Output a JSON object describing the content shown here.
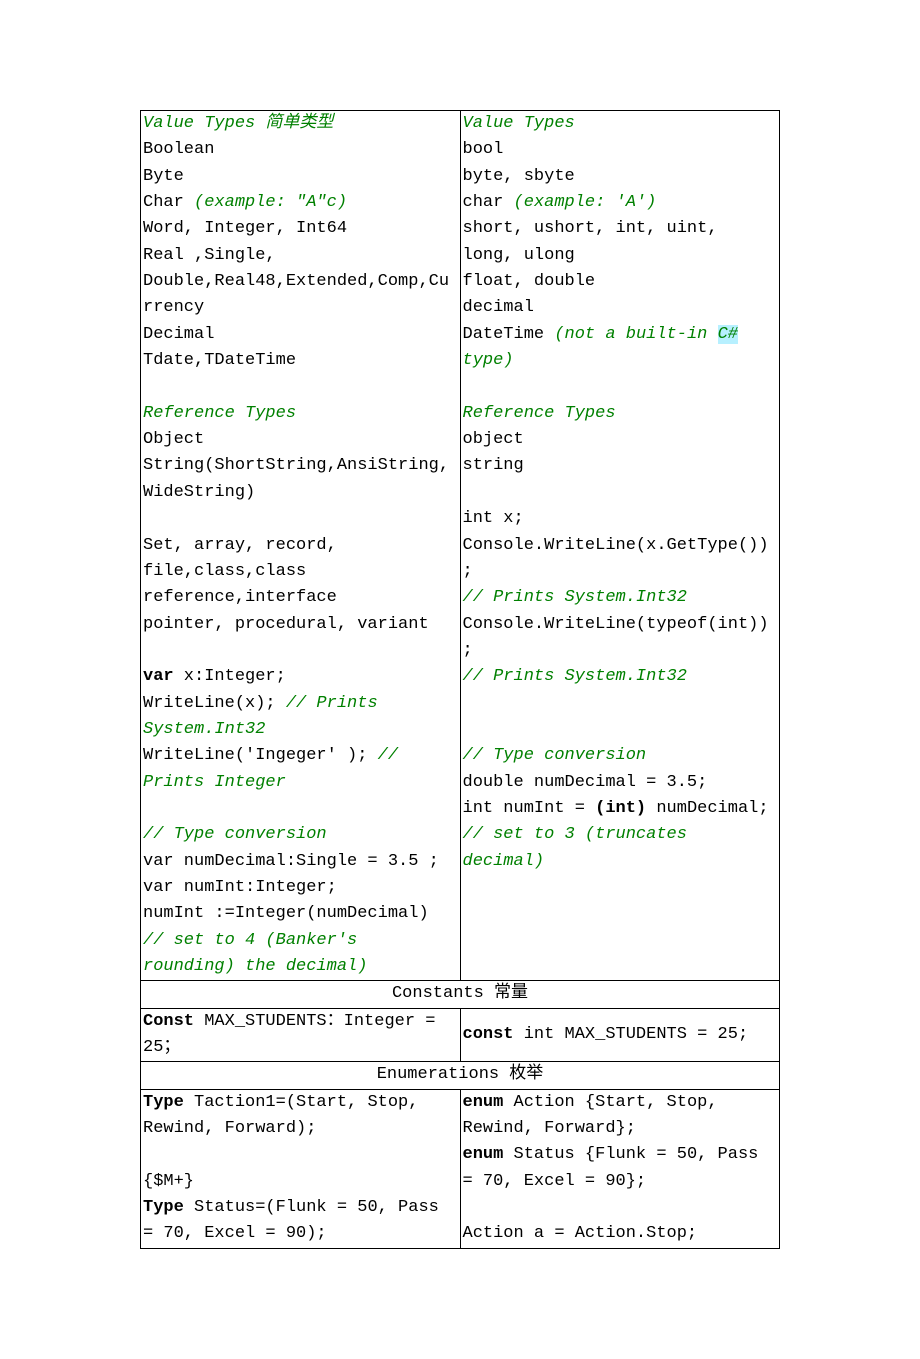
{
  "row1": {
    "left": {
      "h1": "Value Types 简单类型",
      "l1": "Boolean",
      "l2": "Byte",
      "l3a": "Char    ",
      "l3b": "(example: \"A\"c)",
      "l4": "Word, Integer, Int64",
      "l5": "Real ,Single,",
      "l6": "Double,Real48,Extended,Comp,Currency",
      "l7": "Decimal",
      "l8": "Tdate,TDateTime",
      "h2": "Reference Types",
      "r1": "Object",
      "r2": "String(ShortString,AnsiString,WideString)",
      "r3": "Set, array, record,",
      "r4": "file,class,class reference,interface",
      "r5": "pointer, procedural, variant",
      "v1a": "var",
      "v1b": " x:Integer;",
      "v2a": " WriteLine(x);        ",
      "v2b": "//  Prints System.Int32",
      "v3a": " WriteLine('Ingeger' );   ",
      "v3b": "//  Prints Integer",
      "tc": "//  Type conversion",
      "t1": "var numDecimal:Single = 3.5 ;",
      "t2": "var numInt:Integer;",
      "t3": "numInt :=Integer(numDecimal)  ",
      "t4": "// set to 4 (Banker's rounding) the decimal)"
    },
    "right": {
      "h1": "Value Types",
      "l1": "bool",
      "l2": "byte, sbyte",
      "l3a": "char    ",
      "l3b": "(example: 'A')",
      "l4": "short, ushort, int, uint, long, ulong",
      "l5": "float,  double",
      "l6": "decimal",
      "l7a": "DateTime    ",
      "l7b": "(not a built-in ",
      "l7c": "C#",
      "l7d": "  type)",
      "h2": "Reference Types",
      "r1": "object",
      "r2": "string",
      "c1": "int x;",
      "c2": "Console.WriteLine(x.GetType());",
      "c2c": "      // Prints System.Int32",
      "c3": "Console.WriteLine(typeof(int));",
      "c3c": "      // Prints System.Int32",
      "tc": "// Type conversion",
      "t1": "double numDecimal = 3.5;",
      "t2a": "int numInt = ",
      "t2b": "(int)",
      "t2c": " numDecimal;     ",
      "t2d": "// set to  3   (truncates decimal)"
    }
  },
  "constants_hdr": "Constants 常量",
  "constants": {
    "left_a": "Const",
    "left_b": "  MAX_STUDENTS：Integer = 25；",
    "right_a": "const",
    "right_b": " int MAX_STUDENTS = 25;"
  },
  "enum_hdr": "Enumerations 枚举",
  "enum": {
    "left": {
      "l1a": "Type",
      "l1b": " Taction1=(Start, Stop, Rewind, Forward);",
      "l2": " {$M+}",
      "l3a": "Type",
      "l3b": " Status=(Flunk = 50, Pass = 70, Excel = 90);"
    },
    "right": {
      "l1a": "enum",
      "l1b": " Action {Start, Stop, Rewind, Forward};",
      "l2a": "enum",
      "l2b": " Status {Flunk = 50, Pass = 70, Excel = 90};",
      "l3": "Action a = Action.Stop;"
    }
  }
}
